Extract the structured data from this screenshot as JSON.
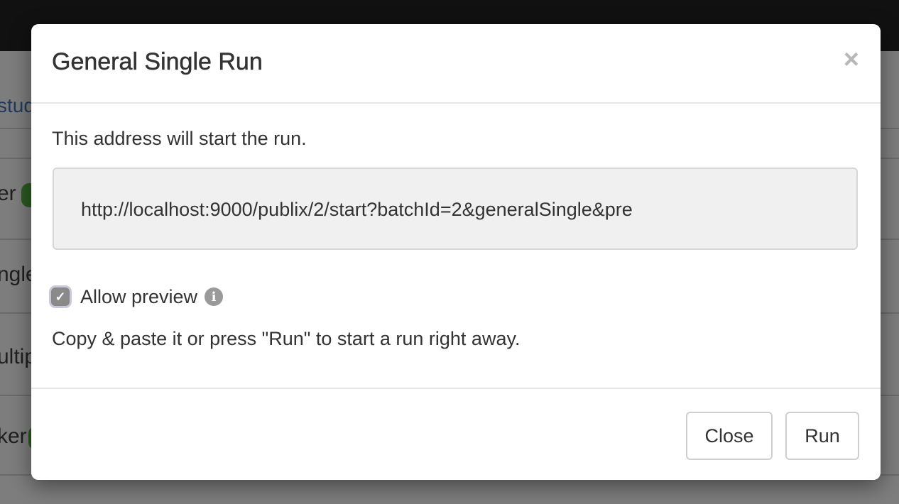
{
  "background": {
    "fragments": [
      "stud",
      "er",
      "ngle",
      "ultip",
      "ker"
    ]
  },
  "modal": {
    "title": "General Single Run",
    "close_symbol": "×",
    "intro_text": "This address will start the run.",
    "url": "http://localhost:9000/publix/2/start?batchId=2&generalSingle&pre",
    "allow_preview": {
      "label": "Allow preview",
      "checked": true,
      "check_symbol": "✓",
      "info_symbol": "i"
    },
    "hint_text": "Copy & paste it or press \"Run\" to start a run right away.",
    "buttons": {
      "close_label": "Close",
      "run_label": "Run"
    }
  },
  "colors": {
    "backdrop": "#7d7d7d",
    "checkbox_fill": "#8a8a8a",
    "url_box_bg": "#f0f0f0"
  }
}
